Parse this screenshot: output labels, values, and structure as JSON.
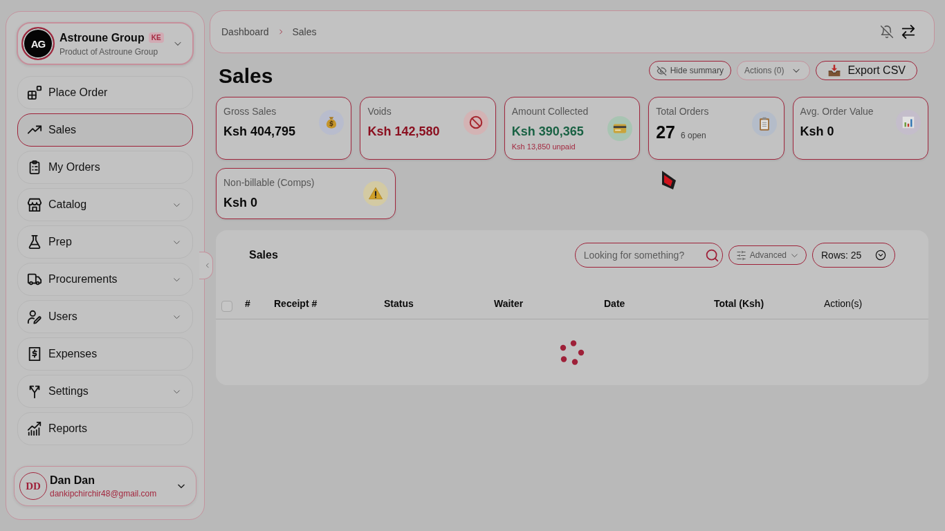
{
  "sidebar": {
    "org": {
      "logo_text": "AG",
      "name": "Astroune Group",
      "badge": "KE",
      "subtitle": "Product of Astroune Group"
    },
    "nav": [
      {
        "label": "Place Order",
        "selected": false,
        "expandable": false
      },
      {
        "label": "Sales",
        "selected": true,
        "expandable": false
      },
      {
        "label": "My Orders",
        "selected": false,
        "expandable": false
      },
      {
        "label": "Catalog",
        "selected": false,
        "expandable": true
      },
      {
        "label": "Prep",
        "selected": false,
        "expandable": true
      },
      {
        "label": "Procurements",
        "selected": false,
        "expandable": true
      },
      {
        "label": "Users",
        "selected": false,
        "expandable": true
      },
      {
        "label": "Expenses",
        "selected": false,
        "expandable": false
      },
      {
        "label": "Settings",
        "selected": false,
        "expandable": true
      },
      {
        "label": "Reports",
        "selected": false,
        "expandable": false
      }
    ],
    "user": {
      "initials": "DD",
      "name": "Dan Dan",
      "email": "dankipchirchir48@gmail.com"
    }
  },
  "topbar": {
    "breadcrumb": [
      "Dashboard",
      "Sales"
    ]
  },
  "page": {
    "title": "Sales",
    "actions": [
      {
        "kind": "toggle",
        "label": "Hide summary",
        "disabled": false
      },
      {
        "kind": "menu",
        "label": "Actions (0)",
        "disabled": true
      },
      {
        "kind": "export",
        "label": "Export CSV",
        "disabled": false
      }
    ]
  },
  "summary": [
    {
      "kind": "money",
      "label": "Gross Sales",
      "value": "Ksh 404,795",
      "color": "#0a0a0a"
    },
    {
      "kind": "money",
      "label": "Voids",
      "value": "Ksh 142,580",
      "color": "#8b1020"
    },
    {
      "kind": "money",
      "label": "Amount Collected",
      "value": "Ksh 390,365",
      "color": "#1a6244",
      "note": "Ksh 13,850 unpaid"
    },
    {
      "kind": "count",
      "label": "Total Orders",
      "value": "27",
      "color": "#0a0a0a",
      "note": "6 open"
    },
    {
      "kind": "money",
      "label": "Avg. Order Value",
      "value": "Ksh 0",
      "color": "#0a0a0a"
    },
    {
      "kind": "money",
      "label": "Non-billable (Comps)",
      "value": "Ksh 0",
      "color": "#0a0a0a"
    }
  ],
  "table": {
    "title": "Sales",
    "search": {
      "placeholder": "Looking for something?"
    },
    "filter": {
      "label": "Advanced"
    },
    "rows_select": {
      "value": "Rows: 25"
    },
    "select_all": {
      "checked": false
    },
    "columns": [
      {
        "label": "#",
        "kind": "data"
      },
      {
        "label": "Receipt #",
        "kind": "data"
      },
      {
        "label": "Status",
        "kind": "data"
      },
      {
        "label": "Waiter",
        "kind": "data"
      },
      {
        "label": "Date",
        "kind": "data"
      },
      {
        "label": "Total (Ksh)",
        "kind": "data"
      },
      {
        "label": "Action(s)",
        "kind": "action"
      }
    ],
    "loading": true
  }
}
